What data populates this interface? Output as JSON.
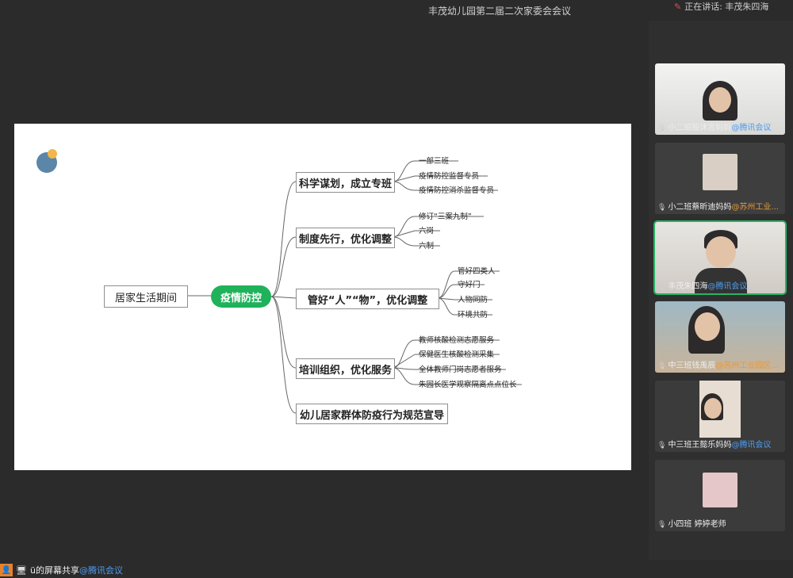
{
  "window": {
    "title": "丰茂幼儿园第二届二次家委会会议",
    "recording": "正在讲话: 丰茂朱四海"
  },
  "mindmap": {
    "root": "居家生活期间",
    "center": "疫情防控",
    "branches": [
      {
        "label": "科学谋划，成立专班",
        "leaves": [
          "一部三班",
          "疫情防控监督专员",
          "疫情防控消杀监督专员"
        ]
      },
      {
        "label": "制度先行，优化调整",
        "leaves": [
          "修订“三案九制”",
          "六岗",
          "六制"
        ]
      },
      {
        "label": "管好“人”“物”，优化调整",
        "leaves": [
          "管好四类人",
          "守好门",
          "人物同防",
          "环境共防"
        ]
      },
      {
        "label": "培训组织，优化服务",
        "leaves": [
          "教师核酸检测志愿服务",
          "保健医生核酸检测采集",
          "全体教师门岗志愿者服务",
          "朱园长医学观察隔离点点位长"
        ]
      },
      {
        "label": "幼儿居家群体防疫行为规范宣导",
        "leaves": []
      }
    ]
  },
  "participants": [
    {
      "name": "小二班殷沐言妈妈",
      "org": "@腾讯会议",
      "org_color": "blue",
      "active": false
    },
    {
      "name": "小二班蔡昕迪妈妈",
      "org": "@苏州工业...",
      "org_color": "orange",
      "active": false
    },
    {
      "name": "丰茂朱四海",
      "org": "@腾讯会议",
      "org_color": "blue",
      "active": true
    },
    {
      "name": "中三班钱禹辰",
      "org": "@苏州工业园区...",
      "org_color": "orange",
      "active": false
    },
    {
      "name": "中三班王懿乐妈妈",
      "org": "@腾讯会议",
      "org_color": "blue",
      "active": false
    },
    {
      "name": "小四班 婷婷老师",
      "org": "",
      "org_color": "blue",
      "active": false
    }
  ],
  "share_status": {
    "owner": "ü的屏幕共享",
    "org": "@腾讯会议"
  },
  "colors": {
    "accent_green": "#1fb25a",
    "link_blue": "#4d9df3"
  }
}
